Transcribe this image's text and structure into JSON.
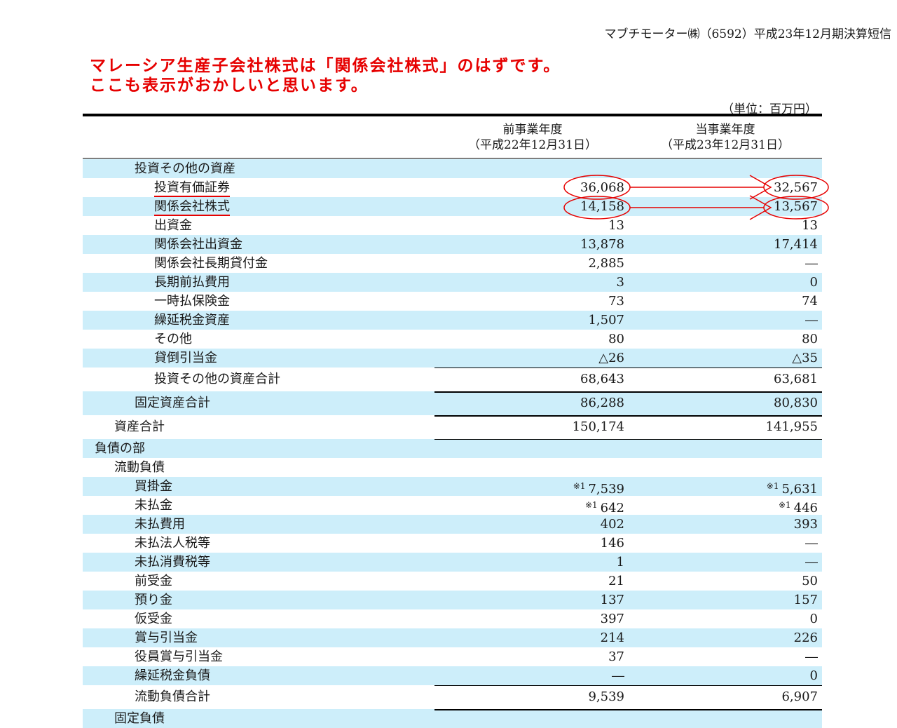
{
  "header": {
    "company": "マブチモーター㈱（6592）平成23年12月期決算短信"
  },
  "annotation": {
    "line1": "マレーシア生産子会社株式は「関係会社株式」のはずです。",
    "line2": "ここも表示がおかしいと思います。",
    "color": "#e60000"
  },
  "unit": "（単位：百万円）",
  "columns": {
    "prev": {
      "title": "前事業年度",
      "date": "（平成22年12月31日）"
    },
    "curr": {
      "title": "当事業年度",
      "date": "（平成23年12月31日）"
    }
  },
  "colors": {
    "shade": "#cdeefa"
  },
  "rows": [
    {
      "label": "投資その他の資産",
      "v1": "",
      "v2": ""
    },
    {
      "label": "投資有価証券",
      "v1": "36,068",
      "v2": "32,567"
    },
    {
      "label": "関係会社株式",
      "v1": "14,158",
      "v2": "13,567"
    },
    {
      "label": "出資金",
      "v1": "13",
      "v2": "13"
    },
    {
      "label": "関係会社出資金",
      "v1": "13,878",
      "v2": "17,414"
    },
    {
      "label": "関係会社長期貸付金",
      "v1": "2,885",
      "v2": "―"
    },
    {
      "label": "長期前払費用",
      "v1": "3",
      "v2": "0"
    },
    {
      "label": "一時払保険金",
      "v1": "73",
      "v2": "74"
    },
    {
      "label": "繰延税金資産",
      "v1": "1,507",
      "v2": "―"
    },
    {
      "label": "その他",
      "v1": "80",
      "v2": "80"
    },
    {
      "label": "貸倒引当金",
      "v1": "△26",
      "v2": "△35"
    },
    {
      "label": "投資その他の資産合計",
      "v1": "68,643",
      "v2": "63,681"
    },
    {
      "label": "固定資産合計",
      "v1": "86,288",
      "v2": "80,830"
    },
    {
      "label": "資産合計",
      "v1": "150,174",
      "v2": "141,955"
    },
    {
      "label": "負債の部",
      "v1": "",
      "v2": ""
    },
    {
      "label": "流動負債",
      "v1": "",
      "v2": ""
    },
    {
      "label": "買掛金",
      "fn1": "※1",
      "v1": "7,539",
      "fn2": "※1",
      "v2": "5,631"
    },
    {
      "label": "未払金",
      "fn1": "※1",
      "v1": "642",
      "fn2": "※1",
      "v2": "446"
    },
    {
      "label": "未払費用",
      "v1": "402",
      "v2": "393"
    },
    {
      "label": "未払法人税等",
      "v1": "146",
      "v2": "―"
    },
    {
      "label": "未払消費税等",
      "v1": "1",
      "v2": "―"
    },
    {
      "label": "前受金",
      "v1": "21",
      "v2": "50"
    },
    {
      "label": "預り金",
      "v1": "137",
      "v2": "157"
    },
    {
      "label": "仮受金",
      "v1": "397",
      "v2": "0"
    },
    {
      "label": "賞与引当金",
      "v1": "214",
      "v2": "226"
    },
    {
      "label": "役員賞与引当金",
      "v1": "37",
      "v2": "―"
    },
    {
      "label": "繰延税金負債",
      "v1": "―",
      "v2": "0"
    },
    {
      "label": "流動負債合計",
      "v1": "9,539",
      "v2": "6,907"
    },
    {
      "label": "固定負債",
      "v1": "",
      "v2": ""
    }
  ]
}
